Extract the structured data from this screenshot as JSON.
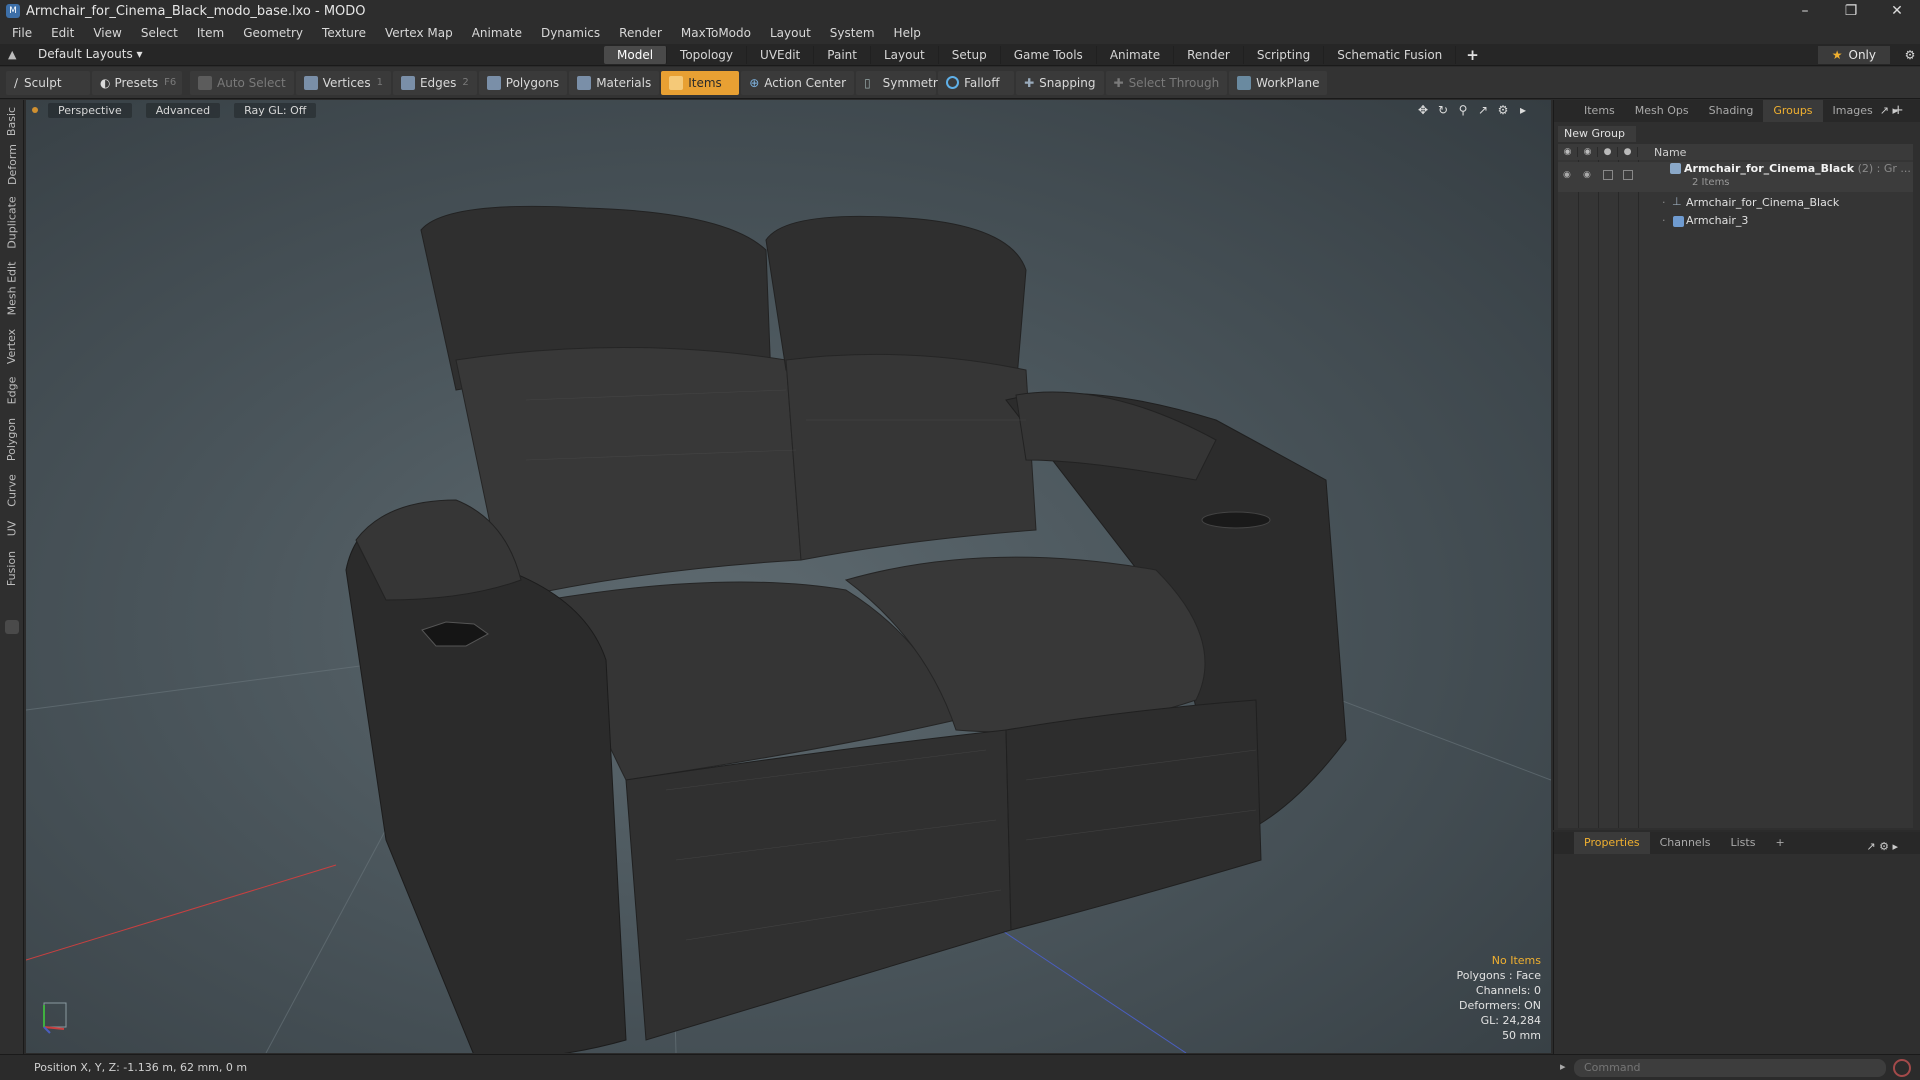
{
  "window": {
    "title": "Armchair_for_Cinema_Black_modo_base.lxo - MODO",
    "app_icon": "modo-icon",
    "controls": [
      "–",
      "❐",
      "✕"
    ]
  },
  "menu": [
    "File",
    "Edit",
    "View",
    "Select",
    "Item",
    "Geometry",
    "Texture",
    "Vertex Map",
    "Animate",
    "Dynamics",
    "Render",
    "MaxToModo",
    "Layout",
    "System",
    "Help"
  ],
  "layoutbar": {
    "layout_select": "Default Layouts ▾",
    "tabs": [
      "Model",
      "Topology",
      "UVEdit",
      "Paint",
      "Layout",
      "Setup",
      "Game Tools",
      "Animate",
      "Render",
      "Scripting",
      "Schematic Fusion"
    ],
    "active_tab": "Model",
    "add_tab": "+",
    "only_label": "Only"
  },
  "toolbar": {
    "sculpt": "Sculpt",
    "presets": "Presets",
    "presets_key": "F6",
    "auto_select": "Auto Select",
    "vertices": "Vertices",
    "vertices_key": "1",
    "edges": "Edges",
    "edges_key": "2",
    "polygons": "Polygons",
    "materials": "Materials",
    "items": "Items",
    "action_center": "Action Center",
    "symmetry": "Symmetry",
    "falloff": "Falloff",
    "snapping": "Snapping",
    "select_through": "Select Through",
    "workplane": "WorkPlane"
  },
  "left_tabs": [
    "Basic",
    "Deform",
    "Duplicate",
    "Mesh Edit",
    "Vertex",
    "Edge",
    "Polygon",
    "Curve",
    "UV",
    "Fusion"
  ],
  "viewport": {
    "view": "Perspective",
    "shading": "Advanced",
    "raygl": "Ray GL: Off",
    "info": {
      "selection": "No Items",
      "polygons": "Polygons : Face",
      "channels": "Channels: 0",
      "deformers": "Deformers: ON",
      "gl": "GL: 24,284",
      "scale": "50 mm"
    }
  },
  "right_panel": {
    "tabs": [
      "Items",
      "Mesh Ops",
      "Shading",
      "Groups",
      "Images"
    ],
    "active_tab": "Groups",
    "add_tab": "+",
    "new_group": "New Group",
    "name_header": "Name",
    "group": {
      "name": "Armchair_for_Cinema_Black",
      "suffix": "(2) : Gr ...",
      "count": "2 Items",
      "children": [
        "Armchair_for_Cinema_Black",
        "Armchair_3"
      ]
    }
  },
  "properties_panel": {
    "tabs": [
      "Properties",
      "Channels",
      "Lists"
    ],
    "active_tab": "Properties",
    "add_tab": "+"
  },
  "status": {
    "position": "Position X, Y, Z:  -1.136 m, 62 mm, 0 m",
    "command_placeholder": "Command"
  },
  "colors": {
    "accent": "#f0b030",
    "items_active": "#e8a033",
    "chair": "#3a3a3a",
    "x_axis": "#c84040",
    "z_axis": "#4a5ec0"
  }
}
